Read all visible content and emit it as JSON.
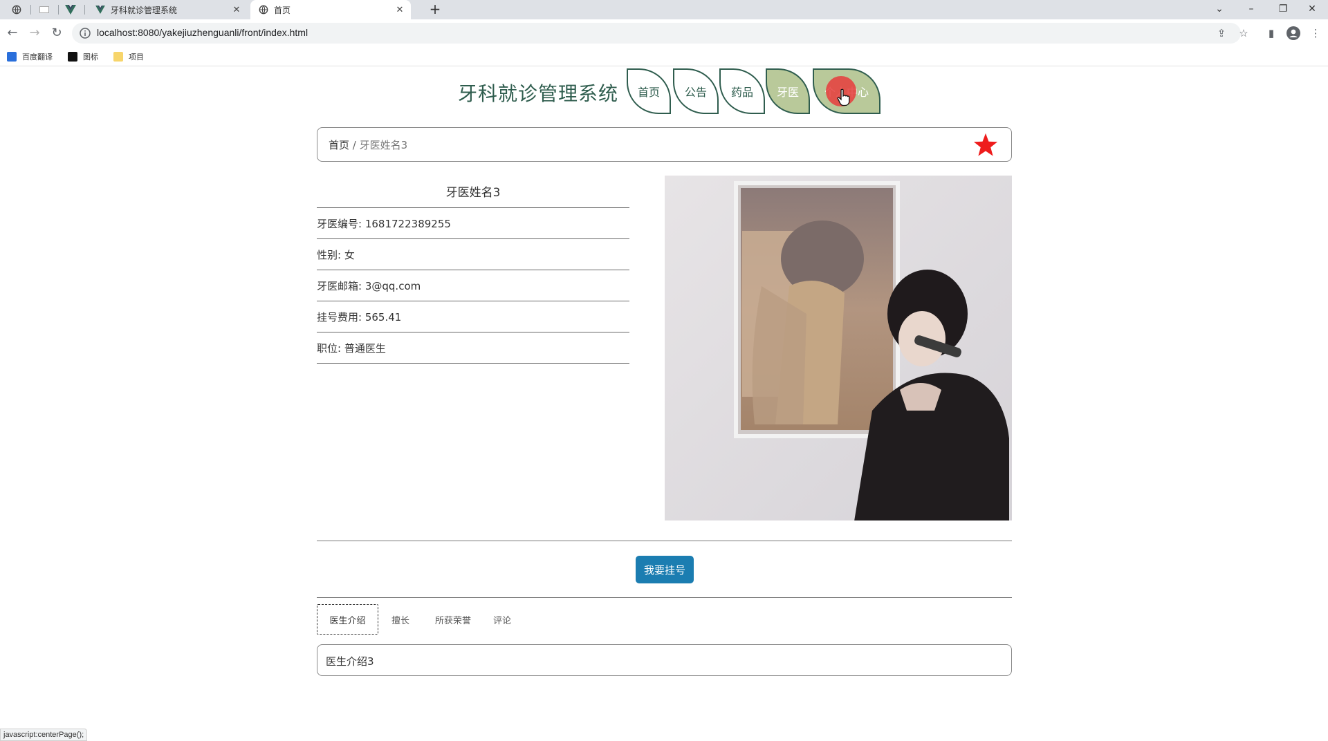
{
  "browser": {
    "tabs": [
      {
        "title": "牙科就诊管理系统",
        "active": false
      },
      {
        "title": "首页",
        "active": true
      }
    ],
    "url": "localhost:8080/yakejiuzhenguanli/front/index.html",
    "bookmarks": [
      "百度翻译",
      "图标",
      "项目"
    ],
    "status_text": "javascript:centerPage();"
  },
  "site": {
    "title": "牙科就诊管理系统",
    "nav": [
      "首页",
      "公告",
      "药品",
      "牙医",
      "个人中心"
    ],
    "active_nav": "牙医"
  },
  "breadcrumb": {
    "home": "首页",
    "separator": "/",
    "current": "牙医姓名3"
  },
  "doctor": {
    "name": "牙医姓名3",
    "fields": [
      {
        "label": "牙医编号:",
        "value": "1681722389255"
      },
      {
        "label": "性别:",
        "value": "女"
      },
      {
        "label": "牙医邮箱:",
        "value": "3@qq.com"
      },
      {
        "label": "挂号费用:",
        "value": "565.41"
      },
      {
        "label": "职位:",
        "value": "普通医生"
      }
    ]
  },
  "actions": {
    "book_label": "我要挂号"
  },
  "content_tabs": [
    "医生介绍",
    "擅长",
    "所获荣誉",
    "评论"
  ],
  "intro_text": "医生介绍3",
  "colors": {
    "brand_green": "#2f5d4e",
    "nav_highlight": "#b9c99a",
    "button_blue": "#1b7db1",
    "favorite_star": "#ee1c1c"
  }
}
